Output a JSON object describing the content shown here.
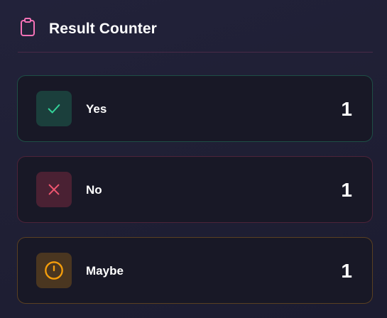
{
  "header": {
    "title": "Result Counter",
    "icon": "clipboard-icon",
    "icon_color": "#f472b6",
    "divider_color": "#4a2a48"
  },
  "results": [
    {
      "label": "Yes",
      "count": "1",
      "icon": "check-icon",
      "accent": "#34d399",
      "border": "#1e4f46",
      "icon_bg": "#1b3f3c"
    },
    {
      "label": "No",
      "count": "1",
      "icon": "x-icon",
      "accent": "#f05670",
      "border": "#4d2339",
      "icon_bg": "#4a2133"
    },
    {
      "label": "Maybe",
      "count": "1",
      "icon": "alert-circle-icon",
      "accent": "#f59e0b",
      "border": "#5a4022",
      "icon_bg": "#4a3620"
    }
  ]
}
